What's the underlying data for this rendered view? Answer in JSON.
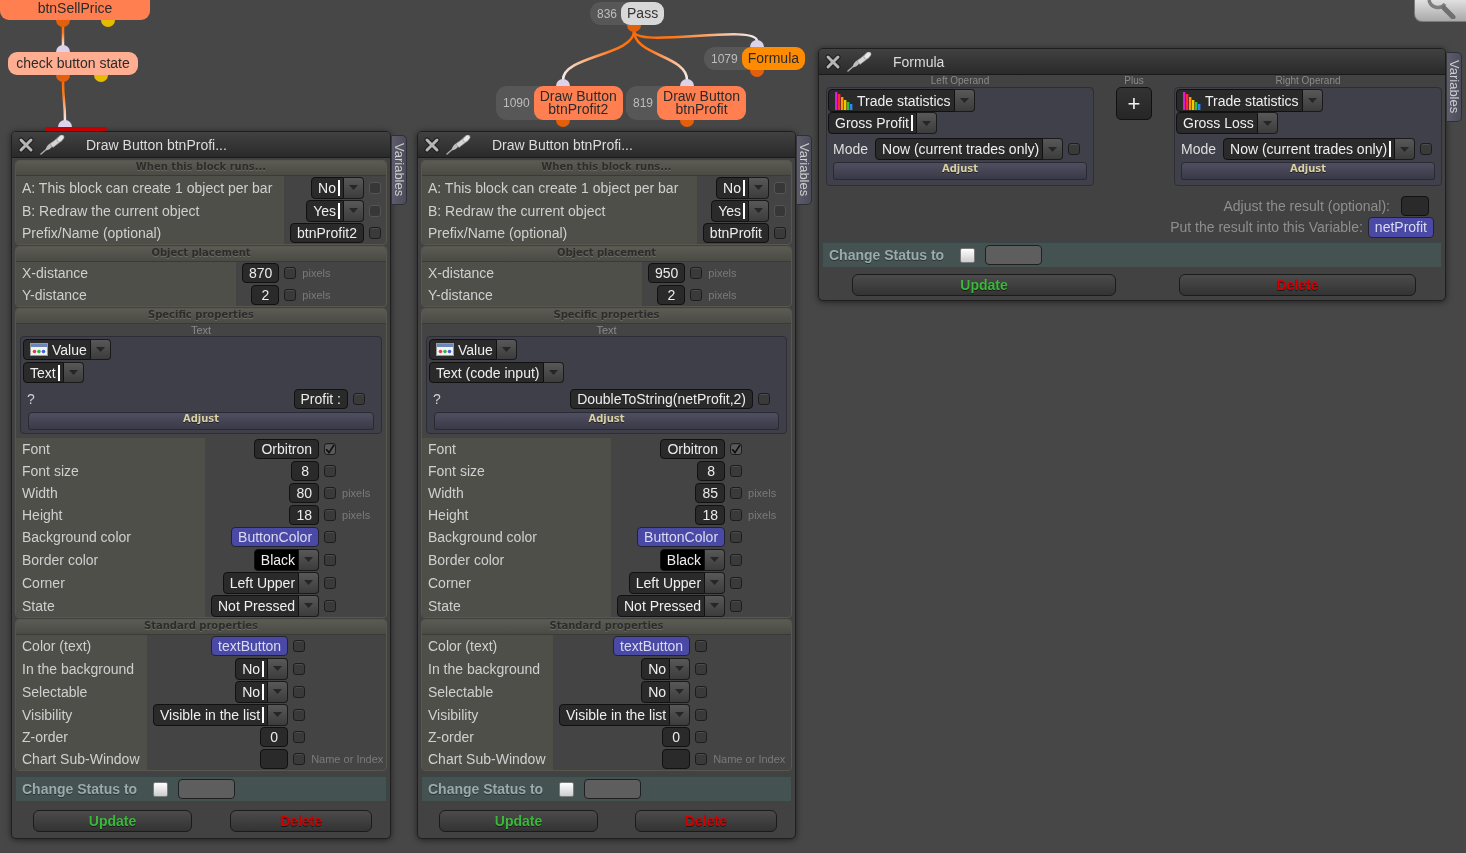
{
  "canvas": {
    "nodes": [
      {
        "kind": "action",
        "lines": [
          "btnSellPrice"
        ],
        "children": [
          {
            "kind": "condition",
            "lines": [
              "check button state"
            ],
            "children": [
              {
                "kind": "alert"
              }
            ]
          }
        ]
      },
      {
        "kind": "pass",
        "number": "836",
        "lines": [
          "Pass"
        ],
        "children": [
          {
            "kind": "formula",
            "number": "1079",
            "lines": [
              "Formula"
            ]
          },
          {
            "kind": "draw",
            "number": "1090",
            "lines": [
              "Draw Button",
              "btnProfit2"
            ]
          },
          {
            "kind": "draw",
            "number": "819",
            "lines": [
              "Draw Button",
              "btnProfit"
            ]
          }
        ]
      }
    ]
  },
  "windows": [
    {
      "kind": "draw_button",
      "title": "Draw Button btnProfi...",
      "side_tab": "Variables",
      "sections": [
        {
          "title": "When this block runs...",
          "rows": [
            {
              "kind": "select",
              "label": "A: This block can create 1 object per bar",
              "value": "No",
              "text_cursor": true,
              "checked": false,
              "disabled": true
            },
            {
              "kind": "select",
              "label": "B: Redraw the current object",
              "value": "Yes",
              "text_cursor": true,
              "checked": false,
              "disabled": true
            },
            {
              "kind": "input",
              "label": "Prefix/Name (optional)",
              "value": "btnProfit2",
              "checked": false,
              "disabled": false
            }
          ]
        },
        {
          "title": "Object placement",
          "rows": [
            {
              "kind": "input",
              "label": "X-distance",
              "value": "870",
              "unit": "pixels",
              "checked": false,
              "disabled": false
            },
            {
              "kind": "input",
              "label": "Y-distance",
              "value": "2",
              "unit": "pixels",
              "checked": false,
              "disabled": false
            }
          ]
        },
        {
          "title": "Specific properties",
          "group": {
            "caption": "Text",
            "source": {
              "value": "Value",
              "text_cursor": false
            },
            "type": {
              "value": "Text",
              "text_cursor": true
            },
            "rows": [
              {
                "kind": "input",
                "label": "?",
                "value": "Profit :",
                "checked": false,
                "disabled": false
              }
            ],
            "adjust": "Adjust"
          },
          "rows": [
            {
              "kind": "input",
              "label": "Font",
              "value": "Orbitron",
              "checked": true,
              "disabled": false
            },
            {
              "kind": "input",
              "label": "Font size",
              "value": "8",
              "checked": false,
              "disabled": false
            },
            {
              "kind": "input",
              "label": "Width",
              "value": "80",
              "unit": "pixels",
              "checked": false,
              "disabled": false
            },
            {
              "kind": "input",
              "label": "Height",
              "value": "18",
              "unit": "pixels",
              "checked": false,
              "disabled": false
            },
            {
              "kind": "variable",
              "label": "Background color",
              "value": "ButtonColor",
              "checked": false,
              "disabled": false
            },
            {
              "kind": "color_select",
              "label": "Border color",
              "value": "Black",
              "color": "#000000",
              "text_cursor": false,
              "checked": false,
              "disabled": false
            },
            {
              "kind": "select",
              "label": "Corner",
              "value": "Left Upper",
              "text_cursor": false,
              "checked": false,
              "disabled": false
            },
            {
              "kind": "select",
              "label": "State",
              "value": "Not Pressed",
              "text_cursor": false,
              "checked": false,
              "disabled": false
            }
          ]
        },
        {
          "title": "Standard properties",
          "rows": [
            {
              "kind": "variable",
              "label": "Color (text)",
              "value": "textButton",
              "checked": false,
              "disabled": false
            },
            {
              "kind": "select",
              "label": "In the background",
              "value": "No",
              "text_cursor": true,
              "checked": false,
              "disabled": false
            },
            {
              "kind": "select",
              "label": "Selectable",
              "value": "No",
              "text_cursor": true,
              "checked": false,
              "disabled": false
            },
            {
              "kind": "select",
              "label": "Visibility",
              "value": "Visible in the list",
              "text_cursor": true,
              "checked": false,
              "disabled": false
            },
            {
              "kind": "input",
              "label": "Z-order",
              "value": "0",
              "checked": false,
              "disabled": false
            },
            {
              "kind": "input",
              "label": "Chart Sub-Window",
              "unit": "Name or Index",
              "checked": false,
              "disabled": false
            }
          ]
        }
      ],
      "status": {
        "label": "Change Status to",
        "checked": false
      },
      "buttons": [
        {
          "kind": "update",
          "label": "Update"
        },
        {
          "kind": "delete",
          "label": "Delete"
        }
      ]
    },
    {
      "kind": "draw_button",
      "title": "Draw Button btnProfi...",
      "side_tab": "Variables",
      "sections": [
        {
          "title": "When this block runs...",
          "rows": [
            {
              "kind": "select",
              "label": "A: This block can create 1 object per bar",
              "value": "No",
              "text_cursor": true,
              "checked": false,
              "disabled": true
            },
            {
              "kind": "select",
              "label": "B: Redraw the current object",
              "value": "Yes",
              "text_cursor": true,
              "checked": false,
              "disabled": true
            },
            {
              "kind": "input",
              "label": "Prefix/Name (optional)",
              "value": "btnProfit",
              "checked": false,
              "disabled": false
            }
          ]
        },
        {
          "title": "Object placement",
          "rows": [
            {
              "kind": "input",
              "label": "X-distance",
              "value": "950",
              "unit": "pixels",
              "checked": false,
              "disabled": false
            },
            {
              "kind": "input",
              "label": "Y-distance",
              "value": "2",
              "unit": "pixels",
              "checked": false,
              "disabled": false
            }
          ]
        },
        {
          "title": "Specific properties",
          "group": {
            "caption": "Text",
            "source": {
              "value": "Value",
              "text_cursor": false
            },
            "type": {
              "value": "Text (code input)",
              "text_cursor": false
            },
            "rows": [
              {
                "kind": "input",
                "label": "?",
                "value": "DoubleToString(netProfit,2)",
                "checked": false,
                "disabled": false
              }
            ],
            "adjust": "Adjust"
          },
          "rows": [
            {
              "kind": "input",
              "label": "Font",
              "value": "Orbitron",
              "checked": true,
              "disabled": false
            },
            {
              "kind": "input",
              "label": "Font size",
              "value": "8",
              "checked": false,
              "disabled": false
            },
            {
              "kind": "input",
              "label": "Width",
              "value": "85",
              "unit": "pixels",
              "checked": false,
              "disabled": false
            },
            {
              "kind": "input",
              "label": "Height",
              "value": "18",
              "unit": "pixels",
              "checked": false,
              "disabled": false
            },
            {
              "kind": "variable",
              "label": "Background color",
              "value": "ButtonColor",
              "checked": false,
              "disabled": false
            },
            {
              "kind": "color_select",
              "label": "Border color",
              "value": "Black",
              "color": "#000000",
              "text_cursor": false,
              "checked": false,
              "disabled": false
            },
            {
              "kind": "select",
              "label": "Corner",
              "value": "Left Upper",
              "text_cursor": false,
              "checked": false,
              "disabled": false
            },
            {
              "kind": "select",
              "label": "State",
              "value": "Not Pressed",
              "text_cursor": false,
              "checked": false,
              "disabled": false
            }
          ]
        },
        {
          "title": "Standard properties",
          "rows": [
            {
              "kind": "variable",
              "label": "Color (text)",
              "value": "textButton",
              "checked": false,
              "disabled": false
            },
            {
              "kind": "select",
              "label": "In the background",
              "value": "No",
              "text_cursor": false,
              "checked": false,
              "disabled": false
            },
            {
              "kind": "select",
              "label": "Selectable",
              "value": "No",
              "text_cursor": false,
              "checked": false,
              "disabled": false
            },
            {
              "kind": "select",
              "label": "Visibility",
              "value": "Visible in the list",
              "text_cursor": false,
              "checked": false,
              "disabled": false
            },
            {
              "kind": "input",
              "label": "Z-order",
              "value": "0",
              "checked": false,
              "disabled": false
            },
            {
              "kind": "input",
              "label": "Chart Sub-Window",
              "unit": "Name or Index",
              "checked": false,
              "disabled": false
            }
          ]
        }
      ],
      "status": {
        "label": "Change Status to",
        "checked": false
      },
      "buttons": [
        {
          "kind": "update",
          "label": "Update"
        },
        {
          "kind": "delete",
          "label": "Delete"
        }
      ]
    },
    {
      "kind": "formula",
      "title": "Formula",
      "side_tab": "Variables",
      "operands": [
        {
          "caption": "Left Operand",
          "source": {
            "value": "Trade statistics",
            "text_cursor": false
          },
          "metric": {
            "value": "Gross Profit",
            "text_cursor": true
          },
          "mode": {
            "label": "Mode",
            "value": "Now (current trades only)",
            "text_cursor": false,
            "checked": false
          },
          "adjust": "Adjust"
        },
        {
          "caption": "Right Operand",
          "source": {
            "value": "Trade statistics",
            "text_cursor": false
          },
          "metric": {
            "value": "Gross Loss",
            "text_cursor": false
          },
          "mode": {
            "label": "Mode",
            "value": "Now (current trades only)",
            "text_cursor": true,
            "checked": false
          },
          "adjust": "Adjust"
        }
      ],
      "operator": {
        "caption": "Plus",
        "symbol": "+"
      },
      "result_rows": [
        {
          "kind": "input",
          "label": "Adjust the result (optional):"
        },
        {
          "kind": "variable",
          "label": "Put the result into this Variable:",
          "value": "netProfit"
        }
      ],
      "status": {
        "label": "Change Status to",
        "checked": false
      },
      "buttons": [
        {
          "kind": "update",
          "label": "Update"
        },
        {
          "kind": "delete",
          "label": "Delete"
        }
      ]
    }
  ]
}
